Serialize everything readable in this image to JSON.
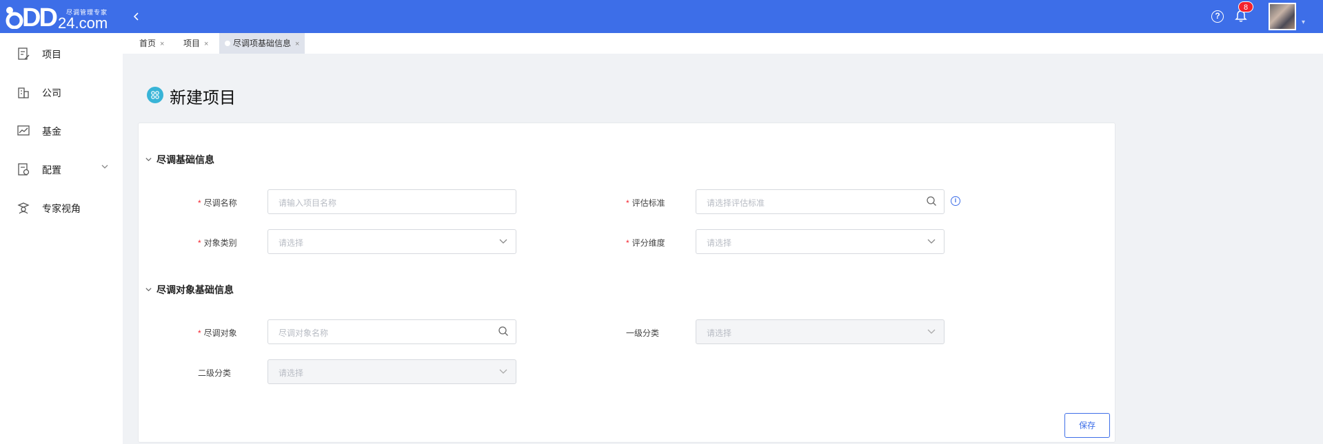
{
  "header": {
    "logo_mark": "DD",
    "logo_domain": "24.com",
    "logo_slogan": "尽调管理专家",
    "collapse_icon": "chevron-left-icon",
    "help_label": "?",
    "notification_count": "8",
    "accent": "#3d6ee8"
  },
  "sidebar": {
    "items": [
      {
        "label": "项目",
        "icon": "project-doc-icon"
      },
      {
        "label": "公司",
        "icon": "building-icon"
      },
      {
        "label": "基金",
        "icon": "chart-line-icon"
      },
      {
        "label": "配置",
        "icon": "config-icon",
        "expandable": true
      },
      {
        "label": "专家视角",
        "icon": "expert-icon"
      }
    ]
  },
  "tabs": [
    {
      "label": "首页",
      "active": false
    },
    {
      "label": "项目",
      "active": false
    },
    {
      "label": "尽调项基础信息",
      "active": true
    }
  ],
  "page": {
    "title": "新建项目",
    "title_icon": "grid-badge-icon"
  },
  "sections": {
    "basic": {
      "title": "尽调基础信息",
      "name_label": "尽调名称",
      "name_placeholder": "请输入项目名称",
      "standard_label": "评估标准",
      "standard_placeholder": "请选择评估标准",
      "category_label": "对象类别",
      "category_placeholder": "请选择",
      "dimension_label": "评分维度",
      "dimension_placeholder": "请选择"
    },
    "target": {
      "title": "尽调对象基础信息",
      "target_label": "尽调对象",
      "target_placeholder": "尽调对象名称",
      "level1_label": "一级分类",
      "level1_placeholder": "请选择",
      "level2_label": "二级分类",
      "level2_placeholder": "请选择"
    }
  },
  "required_marker": "*",
  "actions": {
    "save_label": "保存"
  }
}
